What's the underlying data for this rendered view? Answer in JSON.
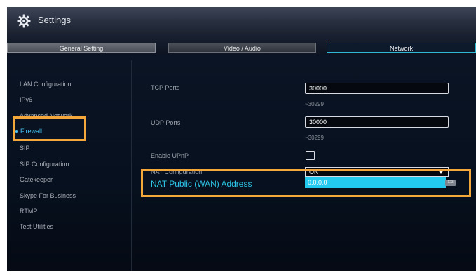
{
  "window": {
    "title": "Settings"
  },
  "tabs": [
    {
      "label": "General Setting"
    },
    {
      "label": "Video / Audio"
    },
    {
      "label": "Network"
    }
  ],
  "sidebar": {
    "items": [
      {
        "label": "LAN Configuration"
      },
      {
        "label": "IPv6"
      },
      {
        "label": "Advanced Network"
      },
      {
        "label": "Firewall",
        "active": true
      },
      {
        "label": "SIP"
      },
      {
        "label": "SIP Configuration"
      },
      {
        "label": "Gatekeeper"
      },
      {
        "label": "Skype For Business"
      },
      {
        "label": "RTMP"
      },
      {
        "label": "Test Utilities"
      }
    ]
  },
  "firewall": {
    "tcp": {
      "label": "TCP Ports",
      "value": "30000",
      "range_end": "~30299"
    },
    "udp": {
      "label": "UDP Ports",
      "value": "30000",
      "range_end": "~30299"
    },
    "upnp": {
      "label": "Enable UPnP",
      "checked": false
    },
    "nat": {
      "label": "NAT Configuration",
      "value": "ON"
    },
    "wan": {
      "label": "NAT Public (WAN) Address",
      "value": "0.0.0.0",
      "keyboard_badge": "123"
    }
  },
  "colors": {
    "accent": "#2ec4e6",
    "highlight": "#f4a83c",
    "field_active": "#23c9ee"
  }
}
